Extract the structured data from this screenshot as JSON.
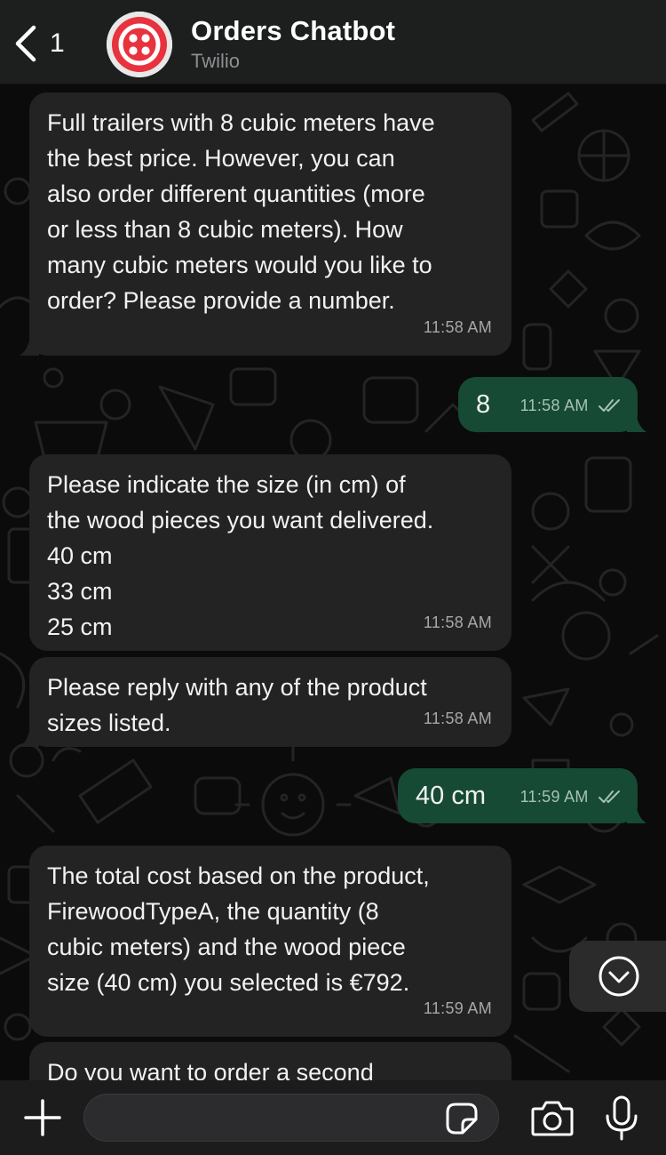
{
  "header": {
    "back_count": "1",
    "title": "Orders Chatbot",
    "subtitle": "Twilio",
    "avatar_icon": "twilio-logo",
    "avatar_color": "#e8323d"
  },
  "messages": [
    {
      "direction": "in",
      "text": "Full trailers with 8 cubic meters have\nthe best price. However, you can\nalso order different quantities (more\nor less than 8 cubic meters). How\nmany cubic meters would you like to\norder? Please provide a number.",
      "time": "11:58 AM"
    },
    {
      "direction": "out",
      "text": "8",
      "time": "11:58 AM",
      "status": "read"
    },
    {
      "direction": "in",
      "text": "Please indicate the size (in cm) of\nthe wood pieces you want delivered.\n40 cm\n33 cm\n25 cm",
      "time": "11:58 AM"
    },
    {
      "direction": "in",
      "text": "Please reply with any of the product\nsizes listed.",
      "time": "11:58 AM"
    },
    {
      "direction": "out",
      "text": "40 cm",
      "time": "11:59 AM",
      "status": "read"
    },
    {
      "direction": "in",
      "text": "The total cost based on the product,\nFirewoodTypeA, the quantity (8\ncubic meters) and the wood piece\nsize (40 cm) you selected is €792.",
      "time": "11:59 AM"
    },
    {
      "direction": "in",
      "text": "Do you want to order a second",
      "time": ""
    }
  ],
  "composer": {
    "value": "",
    "placeholder": ""
  },
  "colors": {
    "incoming_bubble": "#232323",
    "outgoing_bubble": "#164a35",
    "background": "#0b0b0b",
    "header": "#1c1f1d"
  },
  "icons": [
    "chevron-left-icon",
    "plus-icon",
    "sticker-icon",
    "camera-icon",
    "microphone-icon",
    "chevron-down-icon",
    "double-check-icon"
  ]
}
